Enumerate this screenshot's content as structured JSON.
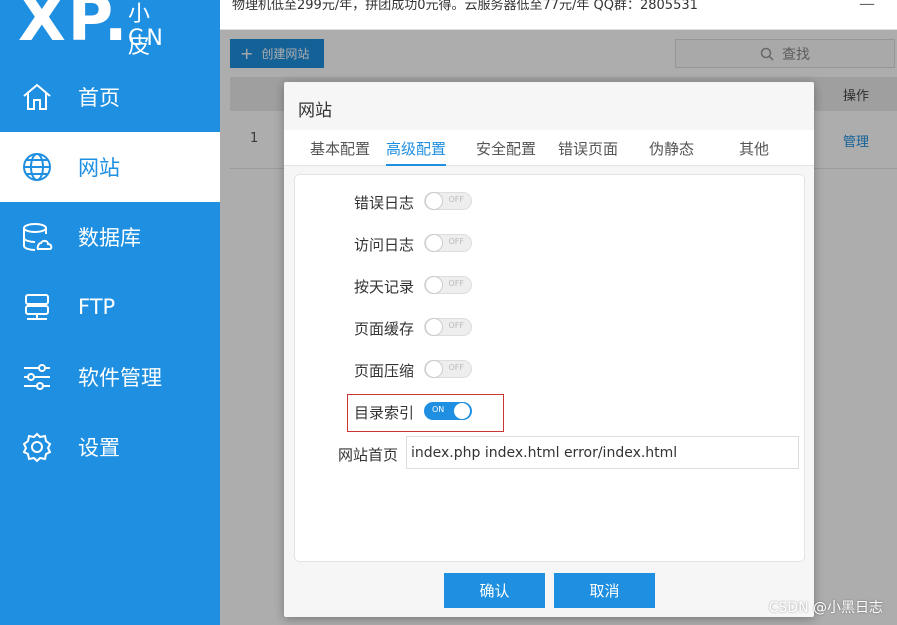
{
  "logo": {
    "brand": "XP.",
    "sub_top": "小皮",
    "sub": "CN"
  },
  "sidebar": {
    "items": [
      {
        "label": "首页",
        "icon": "home-icon"
      },
      {
        "label": "网站",
        "icon": "globe-icon"
      },
      {
        "label": "数据库",
        "icon": "database-icon"
      },
      {
        "label": "FTP",
        "icon": "server-icon"
      },
      {
        "label": "软件管理",
        "icon": "sliders-icon"
      },
      {
        "label": "设置",
        "icon": "gear-icon"
      }
    ],
    "active": "网站"
  },
  "topbar": {
    "text": "物理机低至299元/年，拼团成功0元得。云服务器低至77元/年 QQ群：2805531",
    "close": "—"
  },
  "main": {
    "create_button": "创建网站",
    "search_placeholder": "查找",
    "table": {
      "action_header": "操作",
      "rows": [
        {
          "num": "1",
          "action": "管理"
        }
      ]
    }
  },
  "dialog": {
    "title": "网站",
    "tabs": [
      "基本配置",
      "高级配置",
      "安全配置",
      "错误页面",
      "伪静态",
      "其他"
    ],
    "active_tab": "高级配置",
    "settings": [
      {
        "label": "错误日志",
        "state": "OFF"
      },
      {
        "label": "访问日志",
        "state": "OFF"
      },
      {
        "label": "按天记录",
        "state": "OFF"
      },
      {
        "label": "页面缓存",
        "state": "OFF"
      },
      {
        "label": "页面压缩",
        "state": "OFF"
      },
      {
        "label": "目录索引",
        "state": "ON"
      }
    ],
    "homepage": {
      "label": "网站首页",
      "value": "index.php index.html error/index.html"
    },
    "confirm": "确认",
    "cancel": "取消"
  },
  "watermark": "CSDN @小黑日志",
  "colors": {
    "primary": "#1e8fe1",
    "highlight": "#cc3333"
  }
}
